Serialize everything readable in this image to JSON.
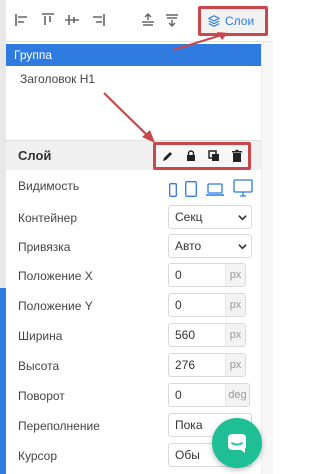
{
  "toolbar": {
    "tools": [
      {
        "icon": "align-left-icon"
      },
      {
        "icon": "align-top-icon"
      },
      {
        "icon": "align-middle-icon"
      },
      {
        "icon": "align-right-icon"
      },
      {
        "icon": "distribute-up-icon"
      },
      {
        "icon": "distribute-down-icon"
      }
    ],
    "layers_button_label": "Слои",
    "accent_color": "#2f7be0",
    "highlight_color": "#c9474b"
  },
  "layers": {
    "selected": "Группа",
    "items": [
      "Заголовок H1"
    ]
  },
  "section": {
    "title": "Слой",
    "actions": [
      {
        "icon": "pencil-icon"
      },
      {
        "icon": "lock-icon"
      },
      {
        "icon": "duplicate-icon"
      },
      {
        "icon": "trash-icon"
      }
    ]
  },
  "properties": {
    "visibility": {
      "label": "Видимость",
      "devices": [
        "phone-icon",
        "tablet-icon",
        "laptop-icon",
        "desktop-icon"
      ]
    },
    "container": {
      "label": "Контейнер",
      "value": "Секц"
    },
    "anchor": {
      "label": "Привязка",
      "value": "Авто"
    },
    "pos_x": {
      "label": "Положение X",
      "value": "0",
      "unit": "px"
    },
    "pos_y": {
      "label": "Положение Y",
      "value": "0",
      "unit": "px"
    },
    "width": {
      "label": "Ширина",
      "value": "560",
      "unit": "px"
    },
    "height": {
      "label": "Высота",
      "value": "276",
      "unit": "px"
    },
    "rotation": {
      "label": "Поворот",
      "value": "0",
      "unit": "deg"
    },
    "overflow": {
      "label": "Переполнение",
      "value": "Пока"
    },
    "cursor": {
      "label": "Курсор",
      "value": "Обы"
    }
  },
  "chat": {
    "icon": "chat-icon",
    "color": "#1fbf96"
  }
}
